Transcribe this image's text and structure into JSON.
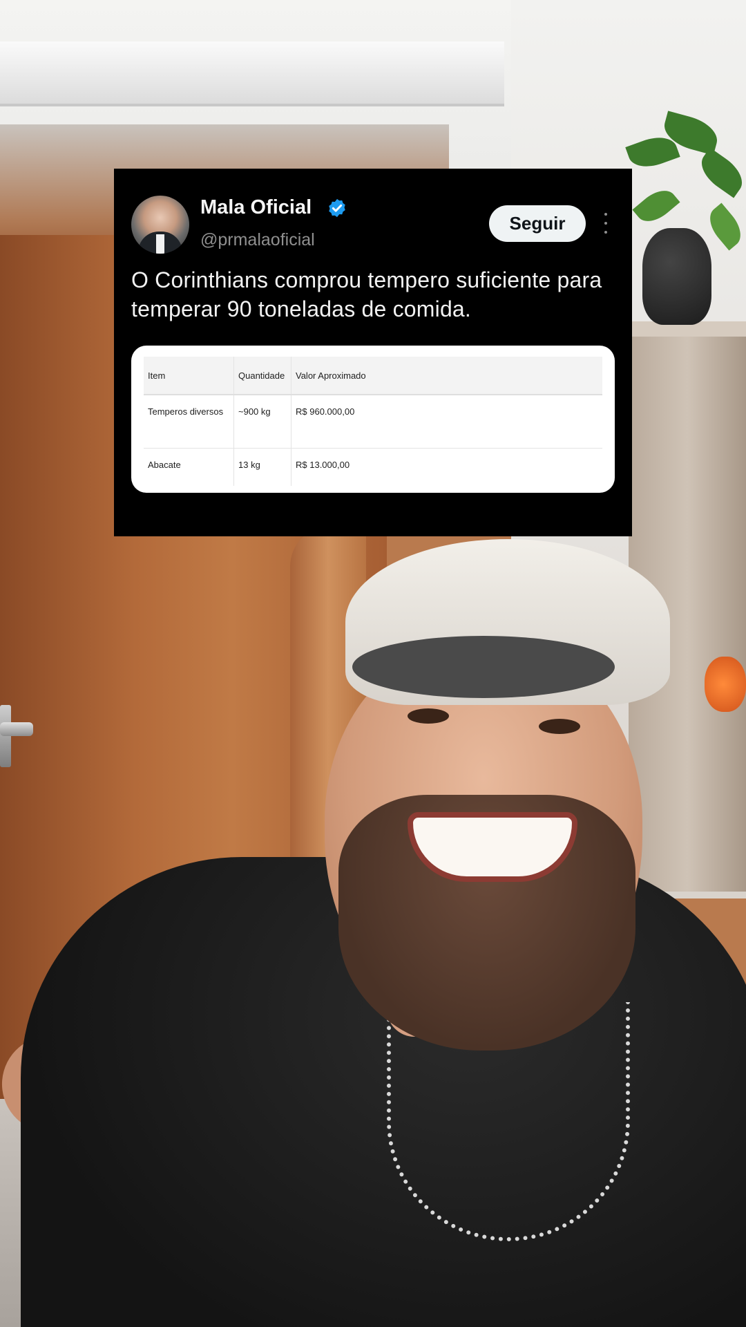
{
  "tweet": {
    "author_name": "Mala Oficial",
    "verified": true,
    "handle": "@prmalaoficial",
    "follow_label": "Seguir",
    "text": "O Corinthians comprou tempero suficiente para temperar 90 toneladas de comida.",
    "accent_color": "#1d9bf0"
  },
  "table": {
    "headers": [
      "Item",
      "Quantidade",
      "Valor Aproximado"
    ],
    "rows": [
      [
        "Temperos diversos",
        "~900 kg",
        "R$ 960.000,00"
      ],
      [
        "Abacate",
        "13 kg",
        "R$ 13.000,00"
      ]
    ]
  },
  "icons": {
    "verified": "verified-badge-icon",
    "more": "more-options-icon"
  }
}
